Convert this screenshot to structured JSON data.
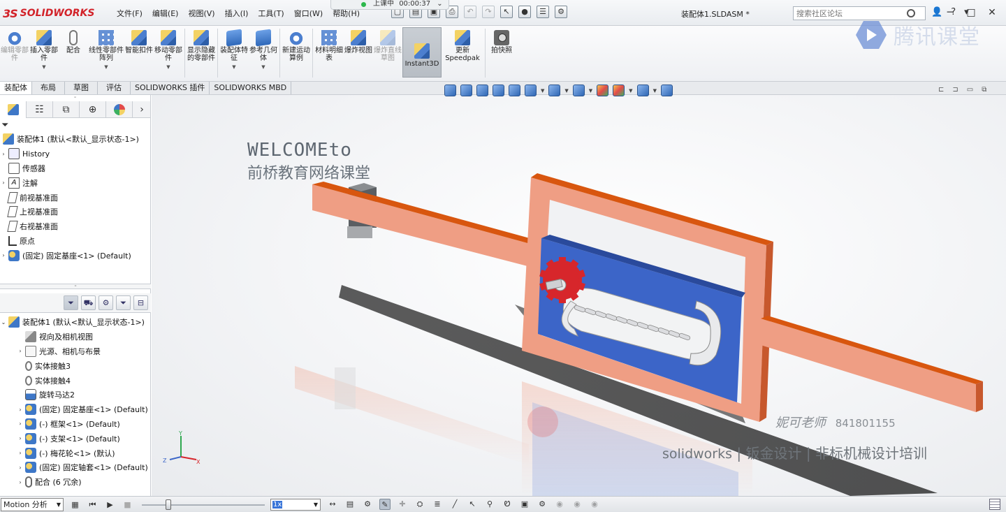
{
  "titlebar": {
    "app_name": "SOLIDWORKS",
    "menu": [
      "文件(F)",
      "编辑(E)",
      "视图(V)",
      "插入(I)",
      "工具(T)",
      "窗口(W)",
      "帮助(H)"
    ],
    "document_title": "装配体1.SLDASM *",
    "search_placeholder": "搜索社区论坛",
    "timer_label": "上课中",
    "timer_value": "00:00:37"
  },
  "watermark": {
    "brand": "腾讯课堂"
  },
  "ribbon": {
    "tools": [
      {
        "label": "编辑零部件",
        "dim": true
      },
      {
        "label": "插入零部件",
        "dim": false
      },
      {
        "label": "配合",
        "dim": false
      },
      {
        "label": "线性零部件阵列",
        "dim": false
      },
      {
        "label": "智能扣件",
        "dim": false
      },
      {
        "label": "移动零部件",
        "dim": false
      },
      {
        "label": "显示隐藏的零部件",
        "dim": false
      },
      {
        "label": "装配体特征",
        "dim": false
      },
      {
        "label": "参考几何体",
        "dim": false
      },
      {
        "label": "新建运动算例",
        "dim": false
      },
      {
        "label": "材料明细表",
        "dim": false
      },
      {
        "label": "爆炸视图",
        "dim": false
      },
      {
        "label": "爆炸直线草图",
        "dim": true
      },
      {
        "label": "Instant3D",
        "dim": false
      },
      {
        "label": "更新Speedpak",
        "dim": false
      },
      {
        "label": "拍快照",
        "dim": false
      }
    ],
    "tabs": [
      "装配体",
      "布局",
      "草图",
      "评估",
      "SOLIDWORKS 插件",
      "SOLIDWORKS MBD"
    ]
  },
  "feature_tree": {
    "root": "装配体1 (默认<默认_显示状态-1>)",
    "items": [
      "History",
      "传感器",
      "注解",
      "前视基准面",
      "上视基准面",
      "右视基准面",
      "原点",
      "(固定) 固定基座<1> (Default)"
    ]
  },
  "motion_tree": {
    "root": "装配体1 (默认<默认_显示状态-1>)",
    "items": [
      "视向及相机视图",
      "光源、相机与布景",
      "实体接触3",
      "实体接触4",
      "旋转马达2",
      "(固定) 固定基座<1> (Default)",
      "(-) 框架<1> (Default)",
      "(-) 支架<1> (Default)",
      "(-) 梅花轮<1> (默认)",
      "(固定) 固定轴套<1> (Default)",
      "配合 (6 冗余)"
    ]
  },
  "graphics": {
    "welcome_line1": "WELCOMEto",
    "welcome_line2": "前桥教育网络课堂",
    "teacher": "妮可老师",
    "teacher_qq": "841801155",
    "slogan_brand": "solidworks",
    "slogan_text": "| 钣金设计 | 非标机械设计培训",
    "colors": {
      "frame": "#ef9e84",
      "frame_edge": "#d8560f",
      "plate": "#3c65c8",
      "gear": "#d7262b"
    }
  },
  "motionbar": {
    "study_type": "Motion 分析",
    "speed": "1x"
  }
}
